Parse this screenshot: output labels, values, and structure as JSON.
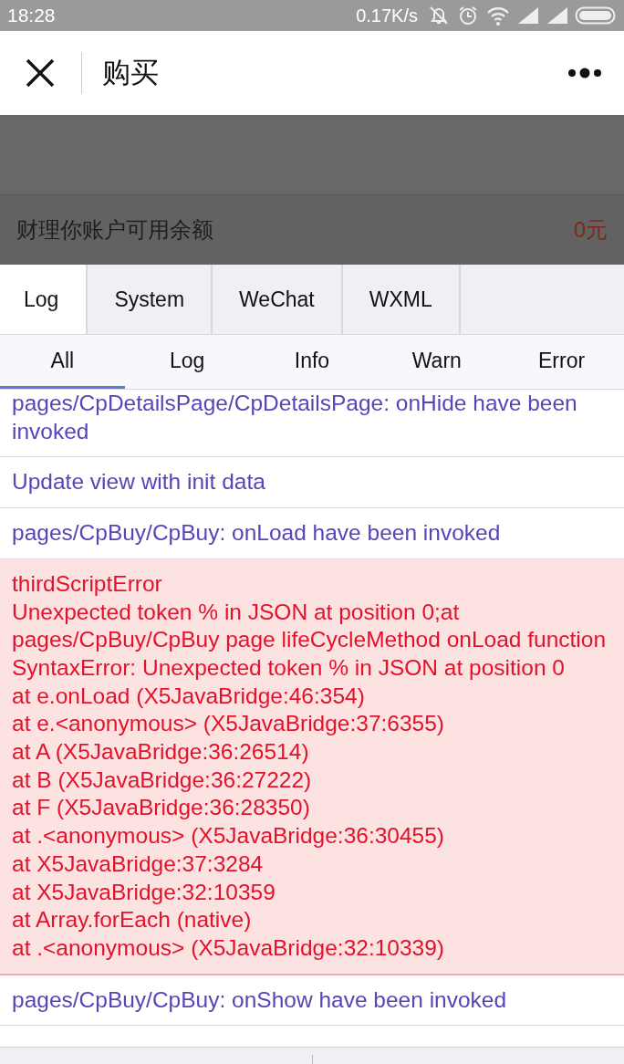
{
  "status_bar": {
    "time": "18:28",
    "speed": "0.17K/s"
  },
  "nav": {
    "title": "购买"
  },
  "balance": {
    "label": "财理你账户可用余额",
    "amount": "0元"
  },
  "tabs": [
    {
      "label": "Log",
      "selected": true
    },
    {
      "label": "System",
      "selected": false
    },
    {
      "label": "WeChat",
      "selected": false
    },
    {
      "label": "WXML",
      "selected": false
    }
  ],
  "filters": [
    {
      "label": "All",
      "selected": true
    },
    {
      "label": "Log",
      "selected": false
    },
    {
      "label": "Info",
      "selected": false
    },
    {
      "label": "Warn",
      "selected": false
    },
    {
      "label": "Error",
      "selected": false
    }
  ],
  "entries": [
    {
      "kind": "log",
      "lines": [
        "pages/CpDetailsPage/CpDetailsPage: onHide have been invoked"
      ]
    },
    {
      "kind": "log",
      "lines": [
        "Update view with init data"
      ]
    },
    {
      "kind": "log",
      "lines": [
        "pages/CpBuy/CpBuy: onLoad have been invoked"
      ]
    },
    {
      "kind": "error",
      "lines": [
        "thirdScriptError",
        "Unexpected token % in JSON at position 0;at pages/CpBuy/CpBuy page lifeCycleMethod onLoad function",
        "SyntaxError: Unexpected token % in JSON at position 0",
        "at e.onLoad (X5JavaBridge:46:354)",
        "at e.<anonymous> (X5JavaBridge:37:6355)",
        "at A (X5JavaBridge:36:26514)",
        "at B (X5JavaBridge:36:27222)",
        "at F (X5JavaBridge:36:28350)",
        "at .<anonymous> (X5JavaBridge:36:30455)",
        "at X5JavaBridge:37:3284",
        "at X5JavaBridge:32:10359",
        "at Array.forEach (native)",
        "at .<anonymous> (X5JavaBridge:32:10339)"
      ]
    },
    {
      "kind": "log",
      "lines": [
        "pages/CpBuy/CpBuy: onShow have been invoked"
      ]
    }
  ]
}
